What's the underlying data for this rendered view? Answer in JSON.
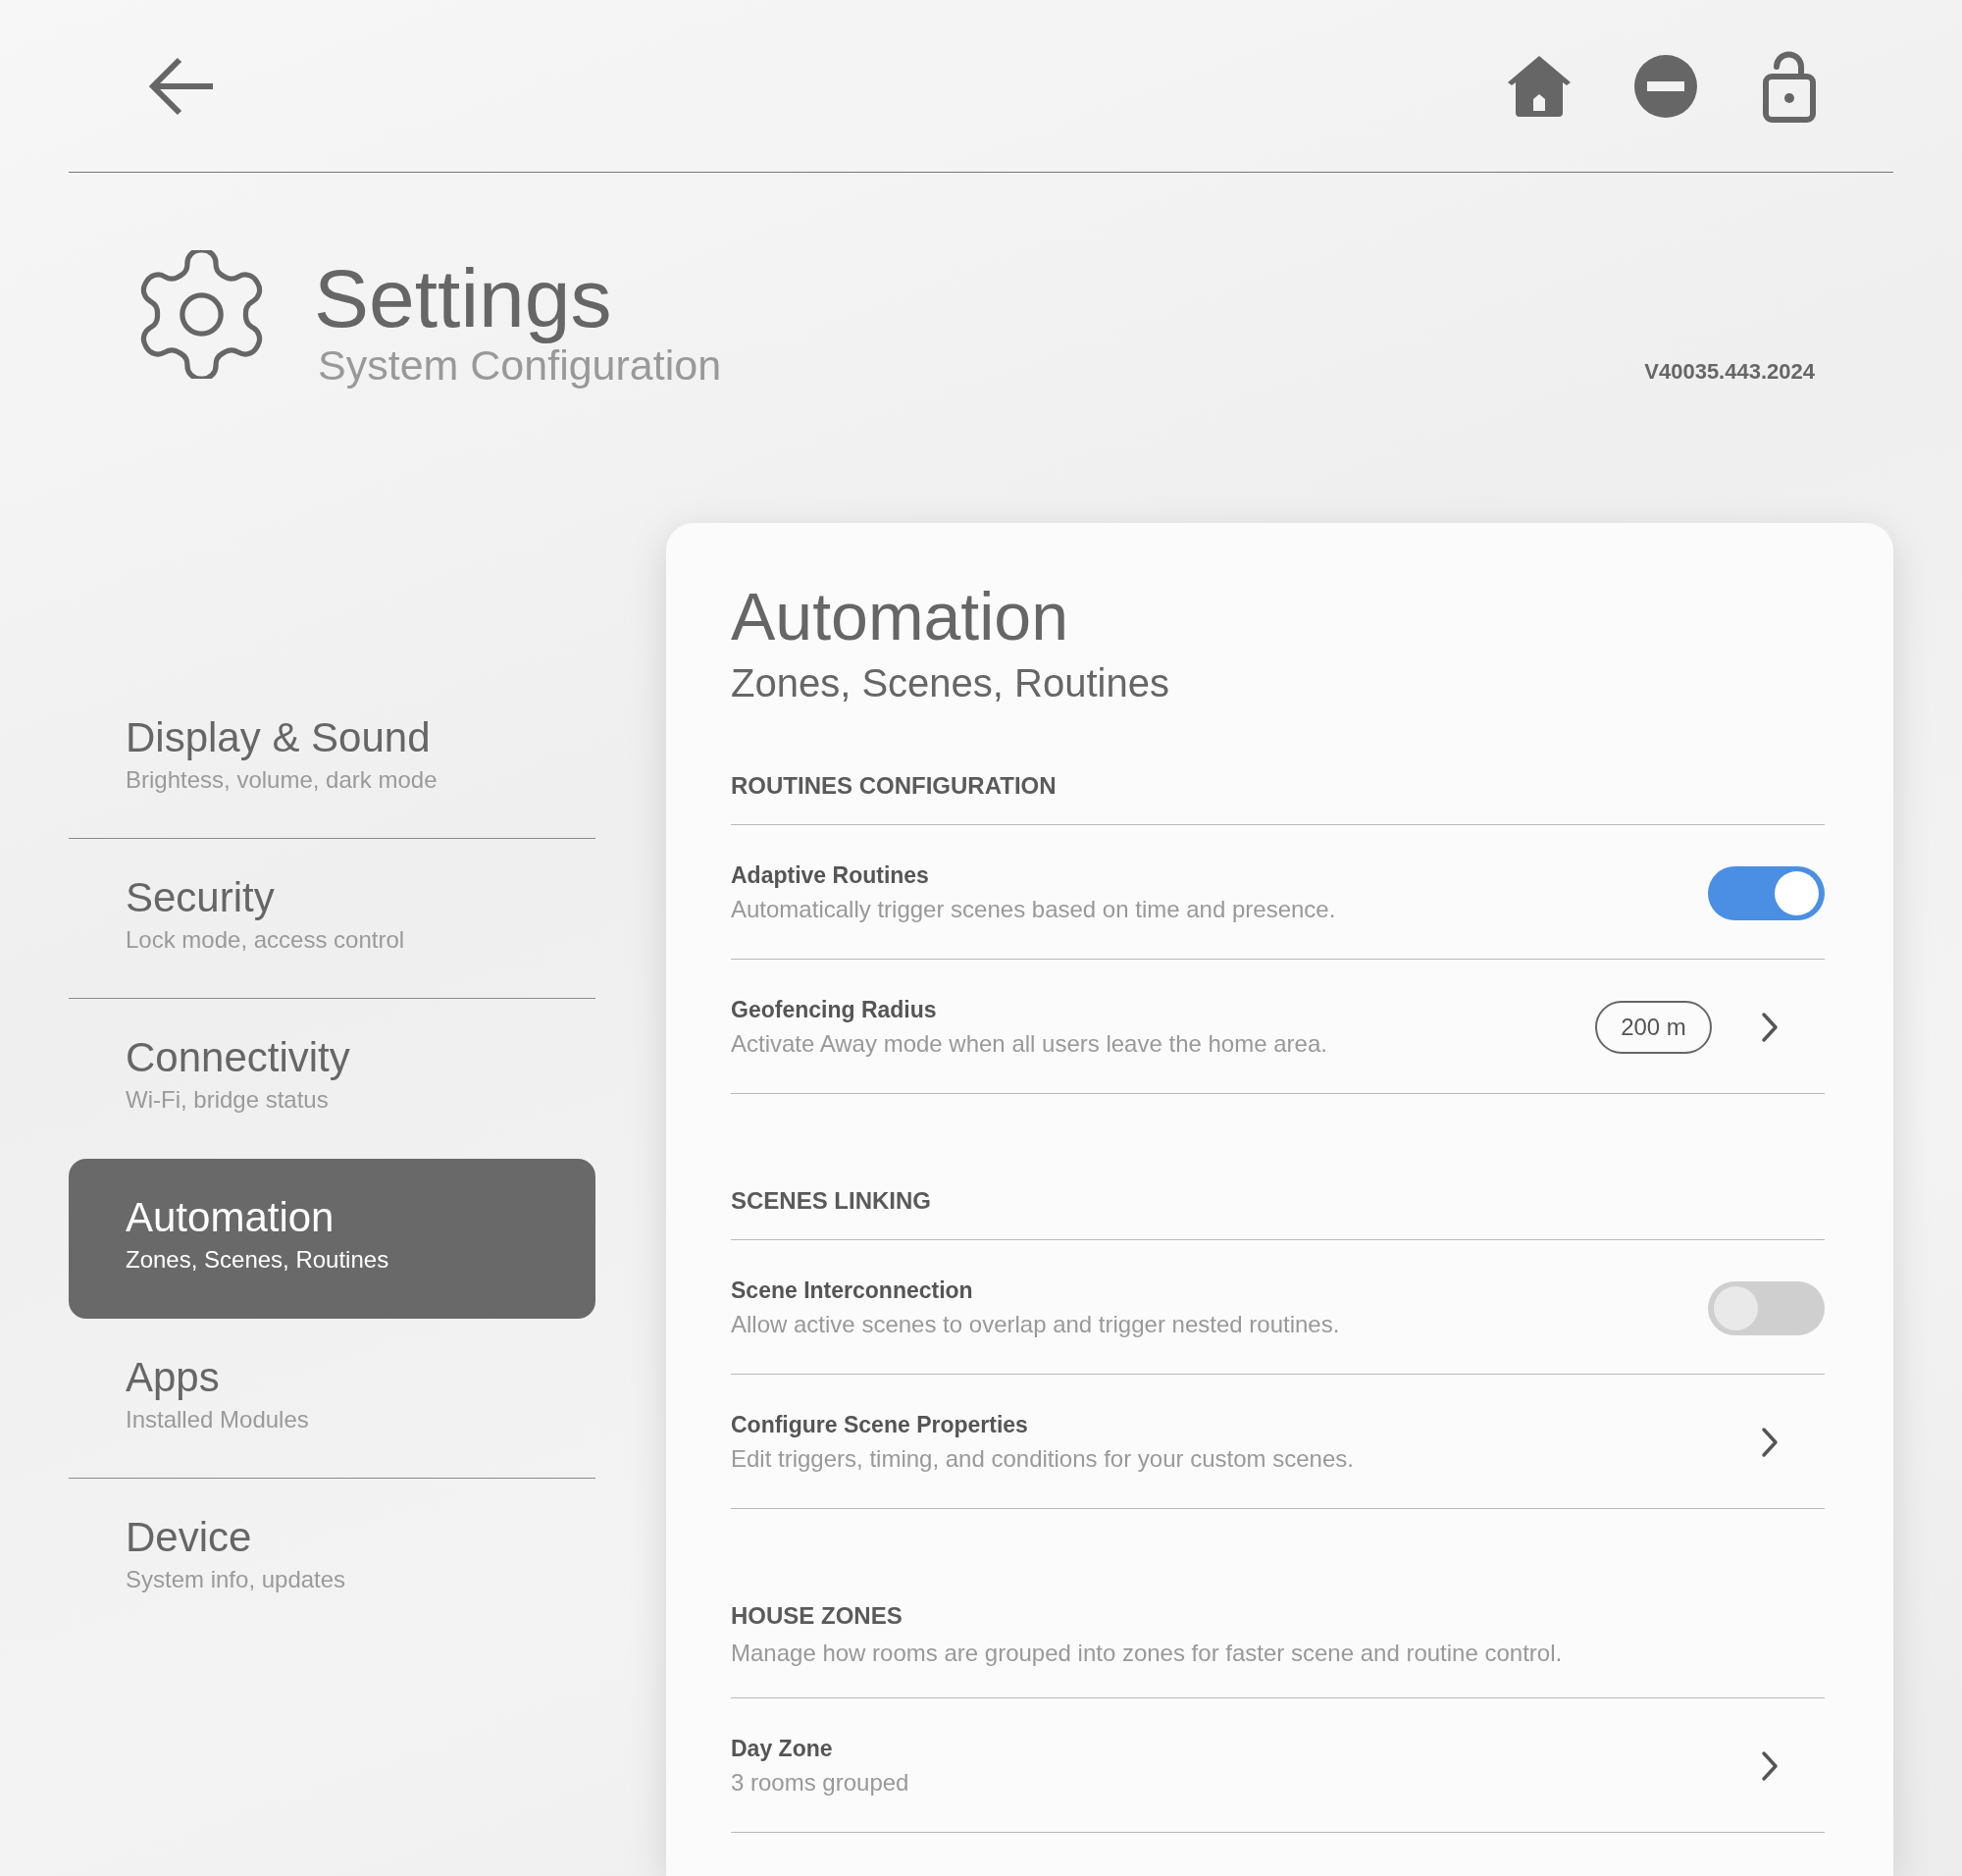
{
  "header": {
    "title": "Settings",
    "subtitle": "System Configuration",
    "version": "V40035.443.2024"
  },
  "sidebar": {
    "items": [
      {
        "title": "Display & Sound",
        "subtitle": "Brightess, volume, dark mode",
        "selected": false
      },
      {
        "title": "Security",
        "subtitle": "Lock mode, access control",
        "selected": false
      },
      {
        "title": "Connectivity",
        "subtitle": "Wi-Fi, bridge status",
        "selected": false
      },
      {
        "title": "Automation",
        "subtitle": "Zones, Scenes, Routines",
        "selected": true
      },
      {
        "title": "Apps",
        "subtitle": "Installed Modules",
        "selected": false
      },
      {
        "title": "Device",
        "subtitle": "System info, updates",
        "selected": false
      }
    ]
  },
  "panel": {
    "title": "Automation",
    "subtitle": "Zones, Scenes, Routines",
    "sections": [
      {
        "heading": "ROUTINES CONFIGURATION",
        "rows": [
          {
            "kind": "toggle",
            "title": "Adaptive Routines",
            "description": "Automatically trigger scenes based on time and presence.",
            "on": true
          },
          {
            "kind": "value",
            "title": "Geofencing Radius",
            "description": "Activate Away mode when all users leave the home area.",
            "value": "200 m"
          }
        ]
      },
      {
        "heading": "SCENES LINKING",
        "rows": [
          {
            "kind": "toggle",
            "title": "Scene Interconnection",
            "description": "Allow active scenes to overlap and trigger nested routines.",
            "on": false
          },
          {
            "kind": "link",
            "title": "Configure Scene Properties",
            "description": "Edit triggers, timing, and conditions for your custom scenes."
          }
        ]
      },
      {
        "heading": "HOUSE ZONES",
        "description": "Manage how rooms are grouped into zones for faster scene and routine control.",
        "rows": [
          {
            "kind": "link",
            "title": "Day Zone",
            "description": "3 rooms grouped"
          }
        ]
      }
    ]
  }
}
